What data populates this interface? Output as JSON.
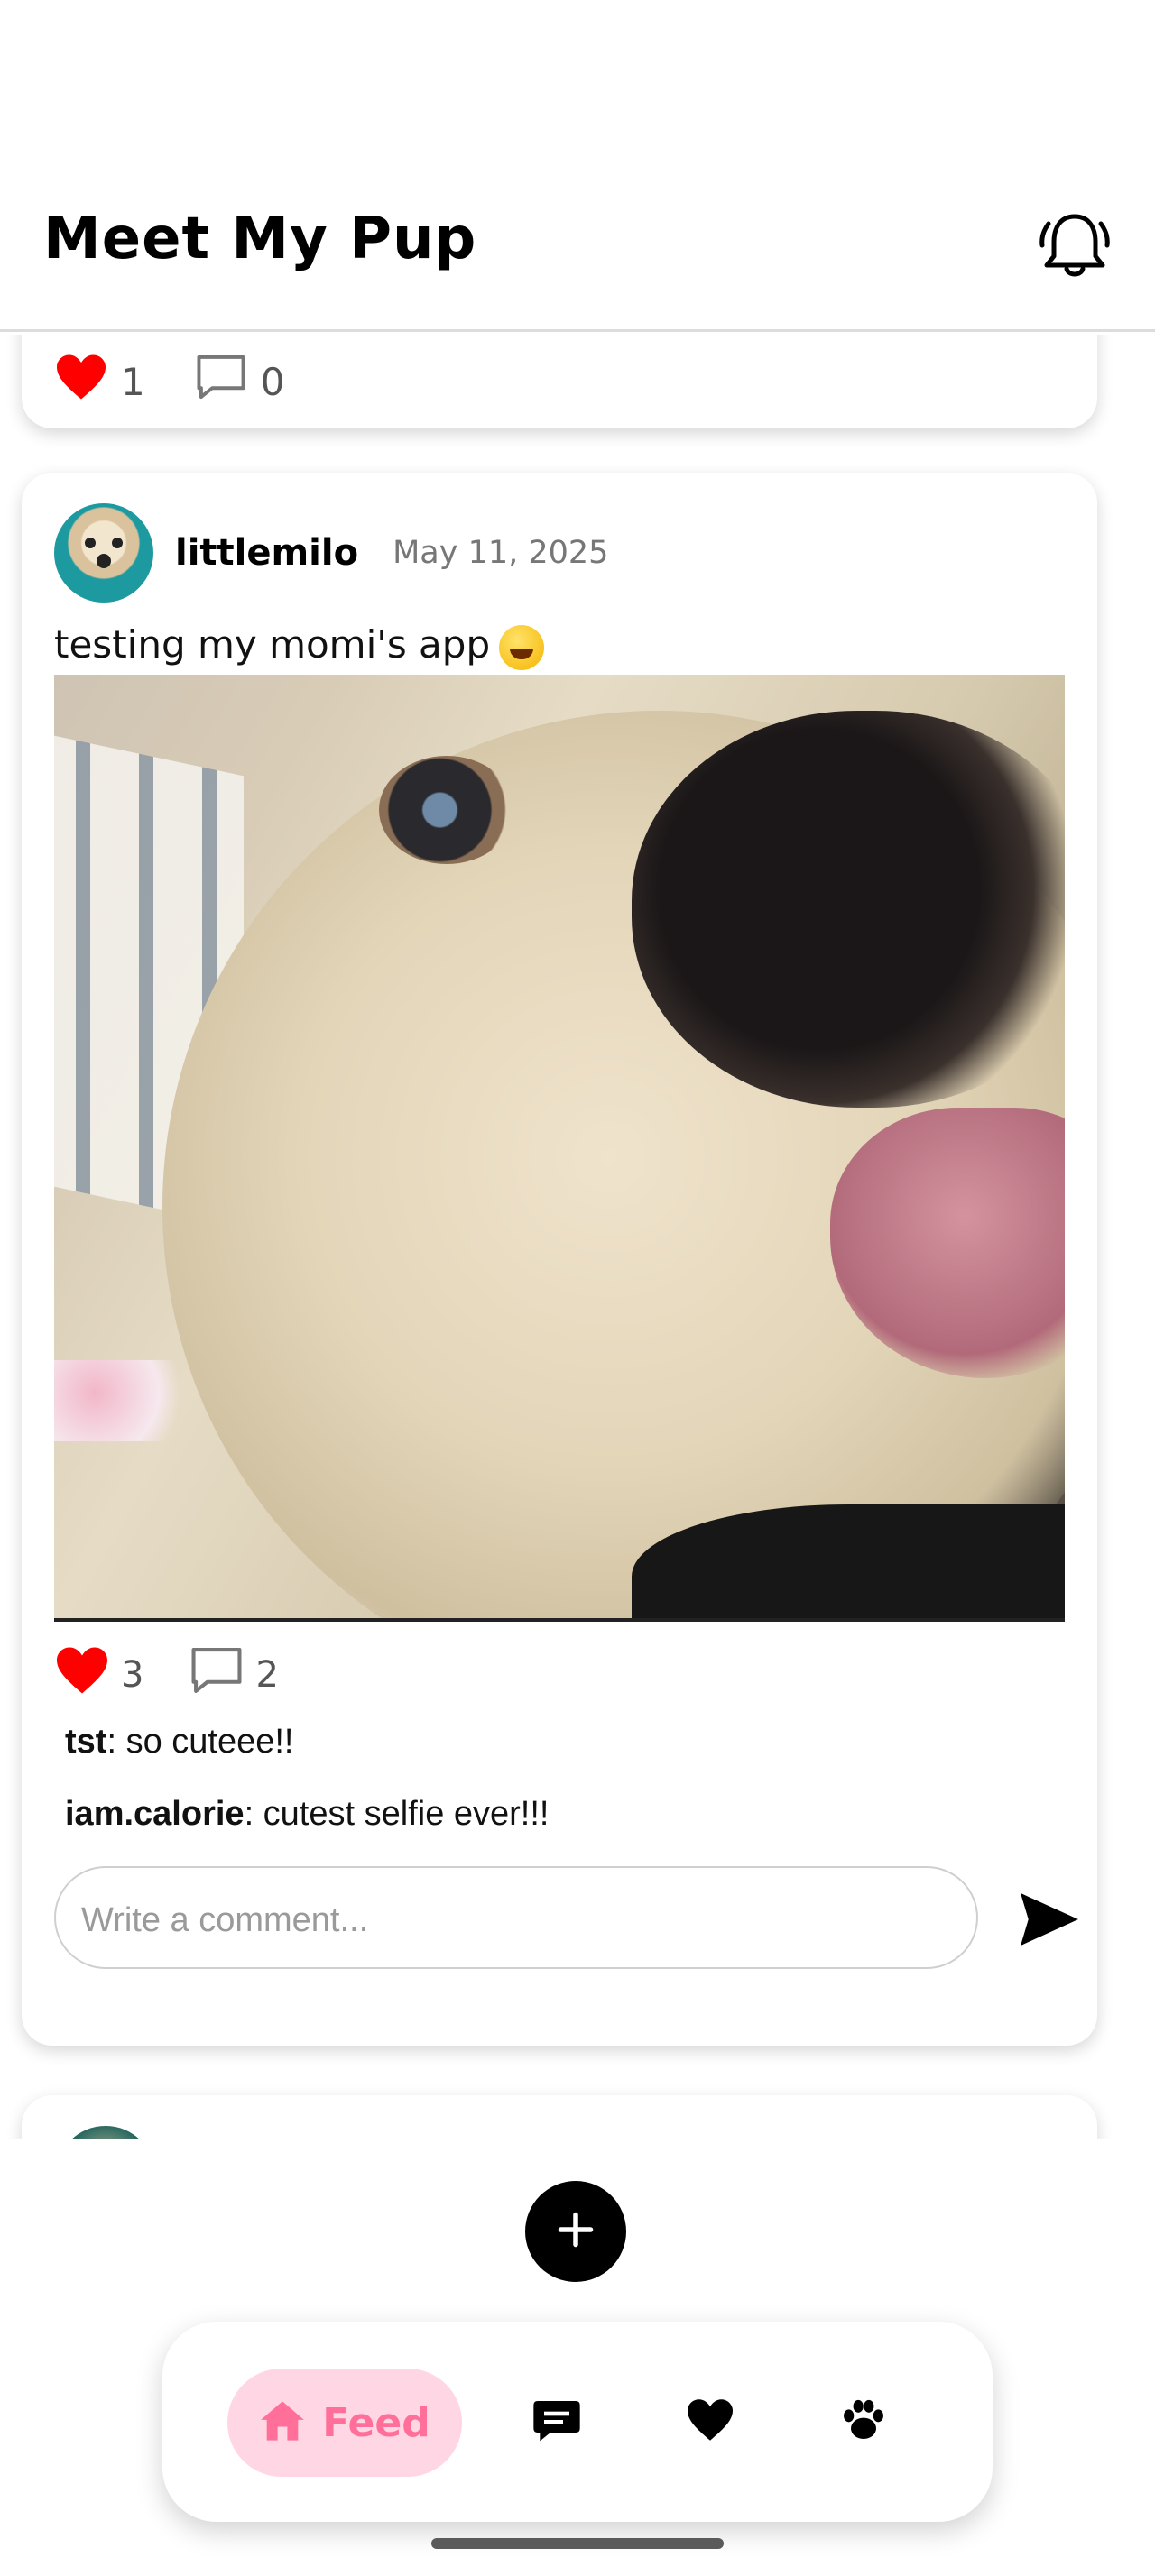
{
  "app": {
    "title": "Meet My Pup"
  },
  "header": {
    "notification_icon": "bell-icon"
  },
  "previous_post": {
    "like_count": "1",
    "comment_count": "0"
  },
  "post": {
    "username": "littlemilo",
    "date": "May 11, 2025",
    "caption": "testing my momi's app",
    "caption_emoji": "grinning-squinting-face",
    "like_count": "3",
    "comment_count": "2",
    "liked": true,
    "comments": [
      {
        "user": "tst",
        "text": ": so cuteee!!"
      },
      {
        "user": "iam.calorie",
        "text": ": cutest selfie ever!!!"
      }
    ],
    "comment_input": {
      "placeholder": "Write a comment...",
      "value": ""
    }
  },
  "bottom_nav": {
    "items": [
      {
        "label": "Feed",
        "icon": "home-icon",
        "active": true
      },
      {
        "label": "",
        "icon": "chat-icon",
        "active": false
      },
      {
        "label": "",
        "icon": "heart-icon",
        "active": false
      },
      {
        "label": "",
        "icon": "paw-icon",
        "active": false
      }
    ]
  },
  "colors": {
    "like_red": "#ff0000",
    "feed_active_bg": "#ffd6e3",
    "feed_active_text": "#ff6f9a",
    "fab": "#000000"
  }
}
